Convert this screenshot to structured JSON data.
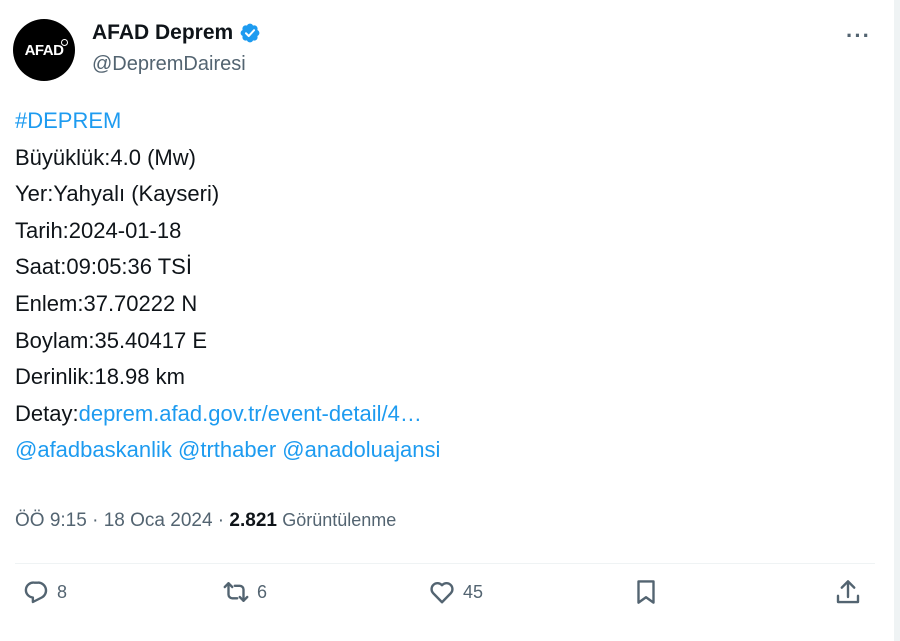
{
  "author": {
    "avatar_text": "AFAD",
    "display_name": "AFAD Deprem",
    "handle": "@DepremDairesi"
  },
  "more_label": "···",
  "tweet": {
    "hashtag": "#DEPREM",
    "lines": [
      "Büyüklük:4.0 (Mw)",
      "Yer:Yahyalı (Kayseri)",
      "Tarih:2024-01-18",
      "Saat:09:05:36 TSİ",
      "Enlem:37.70222 N",
      "Boylam:35.40417 E",
      "Derinlik:18.98 km"
    ],
    "detail_prefix": "Detay:",
    "detail_link": "deprem.afad.gov.tr/event-detail/4…",
    "mentions": [
      "@afadbaskanlik",
      "@trthaber",
      "@anadoluajansi"
    ]
  },
  "meta": {
    "time": "ÖÖ 9:15",
    "separator": " · ",
    "date": "18 Oca 2024",
    "views_count": "2.821",
    "views_label": "Görüntülenme"
  },
  "actions": {
    "reply_count": "8",
    "retweet_count": "6",
    "like_count": "45"
  },
  "colors": {
    "link": "#1d9bf0",
    "text": "#0f1419",
    "secondary": "#536471",
    "verified": "#1d9bf0"
  },
  "icons": [
    "verified-badge-icon",
    "more-icon",
    "reply-icon",
    "retweet-icon",
    "like-icon",
    "bookmark-icon",
    "share-icon"
  ]
}
